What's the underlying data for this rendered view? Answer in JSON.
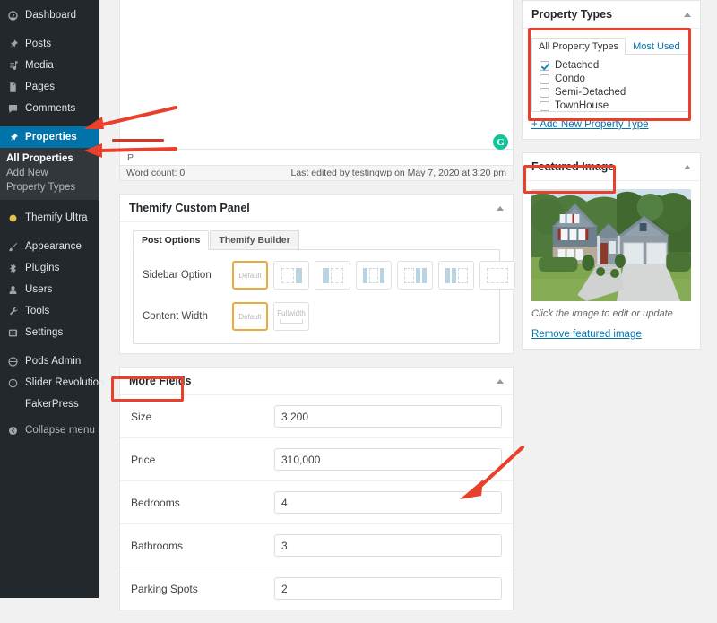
{
  "app": {
    "accent_blue": "#0073aa",
    "sidebar_bg": "#23282d",
    "submenu_bg": "#32373c",
    "annotation_red": "#e8402a",
    "selected_orange": "#e8ab40"
  },
  "sidebar": {
    "items": [
      {
        "label": "Dashboard",
        "icon": "dashboard-icon",
        "current": false
      },
      {
        "label": "Posts",
        "icon": "pin-icon",
        "current": false
      },
      {
        "label": "Media",
        "icon": "media-icon",
        "current": false
      },
      {
        "label": "Pages",
        "icon": "pages-icon",
        "current": false
      },
      {
        "label": "Comments",
        "icon": "comments-icon",
        "current": false
      },
      {
        "label": "Properties",
        "icon": "pin-icon",
        "current": true
      }
    ],
    "submenu": [
      {
        "label": "All Properties",
        "current": true
      },
      {
        "label": "Add New",
        "current": false
      },
      {
        "label": "Property Types",
        "current": false
      }
    ],
    "items_after": [
      {
        "label": "Themify Ultra",
        "icon": "themify-icon",
        "current": false
      },
      {
        "label": "Appearance",
        "icon": "brush-icon",
        "current": false
      },
      {
        "label": "Plugins",
        "icon": "plugin-icon",
        "current": false
      },
      {
        "label": "Users",
        "icon": "users-icon",
        "current": false
      },
      {
        "label": "Tools",
        "icon": "tools-icon",
        "current": false
      },
      {
        "label": "Settings",
        "icon": "settings-icon",
        "current": false
      }
    ],
    "items_plugins": [
      {
        "label": "Pods Admin",
        "icon": "pods-icon",
        "current": false
      },
      {
        "label": "Slider Revolution",
        "icon": "slider-icon",
        "current": false
      },
      {
        "label": "FakerPress",
        "icon": "none-icon",
        "current": false
      },
      {
        "label": "Collapse menu",
        "icon": "collapse-icon",
        "current": false
      }
    ]
  },
  "editor": {
    "path_indicator": "P",
    "word_count": "Word count: 0",
    "last_edited": "Last edited by testingwp on May 7, 2020 at 3:20 pm",
    "grammarly_glyph": "G"
  },
  "property_types": {
    "title": "Property Types",
    "tabs": [
      {
        "label": "All Property Types",
        "active": true
      },
      {
        "label": "Most Used",
        "active": false
      }
    ],
    "options": [
      {
        "label": "Detached",
        "checked": true
      },
      {
        "label": "Condo",
        "checked": false
      },
      {
        "label": "Semi-Detached",
        "checked": false
      },
      {
        "label": "TownHouse",
        "checked": false
      }
    ],
    "add_new_link": "+ Add New Property Type"
  },
  "featured_image": {
    "title": "Featured Image",
    "caption": "Click the image to edit or update",
    "remove_link": "Remove featured image",
    "image_alt": "Two-story blue-gray craftsman house with red shutters, stone accents and a two-car garage"
  },
  "themify_panel": {
    "title": "Themify Custom Panel",
    "tabs": [
      {
        "label": "Post Options",
        "active": true
      },
      {
        "label": "Themify Builder",
        "active": false
      }
    ],
    "sidebar_option": {
      "label": "Sidebar Option",
      "choices": [
        {
          "label": "Default",
          "type": "text",
          "selected": true
        },
        {
          "label": "",
          "type": "sidebar-right",
          "selected": false
        },
        {
          "label": "",
          "type": "sidebar-left",
          "selected": false
        },
        {
          "label": "",
          "type": "sidebar-both",
          "selected": false
        },
        {
          "label": "",
          "type": "two-right",
          "selected": false
        },
        {
          "label": "",
          "type": "two-left",
          "selected": false
        },
        {
          "label": "",
          "type": "no-sidebar",
          "selected": false
        }
      ]
    },
    "content_width": {
      "label": "Content Width",
      "choices": [
        {
          "label": "Default",
          "selected": true
        },
        {
          "label": "Fullwidth",
          "selected": false
        }
      ]
    }
  },
  "more_fields": {
    "title": "More Fields",
    "fields": [
      {
        "label": "Size",
        "value": "3,200"
      },
      {
        "label": "Price",
        "value": "310,000"
      },
      {
        "label": "Bedrooms",
        "value": "4"
      },
      {
        "label": "Bathrooms",
        "value": "3"
      },
      {
        "label": "Parking Spots",
        "value": "2"
      }
    ]
  },
  "annotations": {
    "boxes": [
      {
        "name": "property-types-list-highlight"
      },
      {
        "name": "featured-image-title-highlight"
      },
      {
        "name": "more-fields-title-highlight"
      }
    ],
    "arrows": [
      {
        "name": "arrow-to-properties-menu"
      },
      {
        "name": "arrow-to-all-properties-menu"
      },
      {
        "name": "arrow-to-bedrooms-field"
      }
    ]
  }
}
